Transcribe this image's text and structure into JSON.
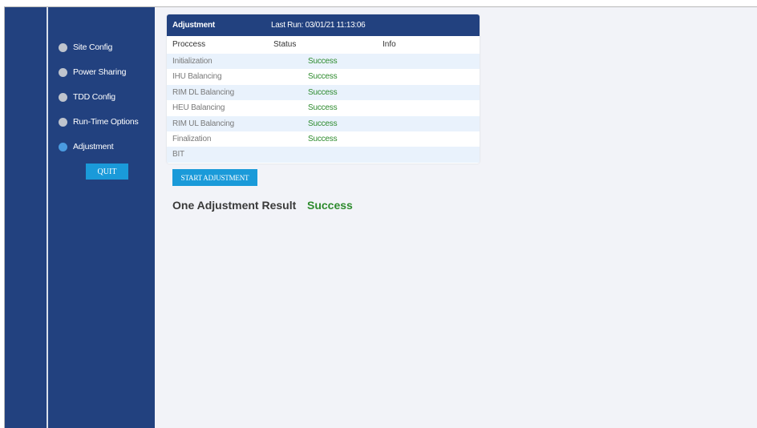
{
  "sidebar": {
    "items": [
      {
        "label": "Site Config",
        "active": false
      },
      {
        "label": "Power Sharing",
        "active": false
      },
      {
        "label": "TDD Config",
        "active": false
      },
      {
        "label": "Run-Time Options",
        "active": false
      },
      {
        "label": "Adjustment",
        "active": true
      }
    ],
    "quit_label": "QUIT"
  },
  "panel": {
    "title": "Adjustment",
    "last_run": "Last Run: 03/01/21 11:13:06",
    "columns": [
      "Proccess",
      "Status",
      "Info"
    ],
    "rows": [
      {
        "process": "Initialization",
        "status": "Success",
        "info": ""
      },
      {
        "process": "IHU Balancing",
        "status": "Success",
        "info": ""
      },
      {
        "process": "RIM DL Balancing",
        "status": "Success",
        "info": ""
      },
      {
        "process": "HEU Balancing",
        "status": "Success",
        "info": ""
      },
      {
        "process": "RIM UL Balancing",
        "status": "Success",
        "info": ""
      },
      {
        "process": "Finalization",
        "status": "Success",
        "info": ""
      },
      {
        "process": "BIT",
        "status": "",
        "info": ""
      }
    ]
  },
  "actions": {
    "start_label": "START ADJUSTMENT"
  },
  "result": {
    "label": "One Adjustment Result",
    "value": "Success"
  },
  "colors": {
    "sidebar_bg": "#22417f",
    "accent": "#1a9ad9",
    "success": "#2e8b2e",
    "active_dot": "#4a9be0"
  }
}
